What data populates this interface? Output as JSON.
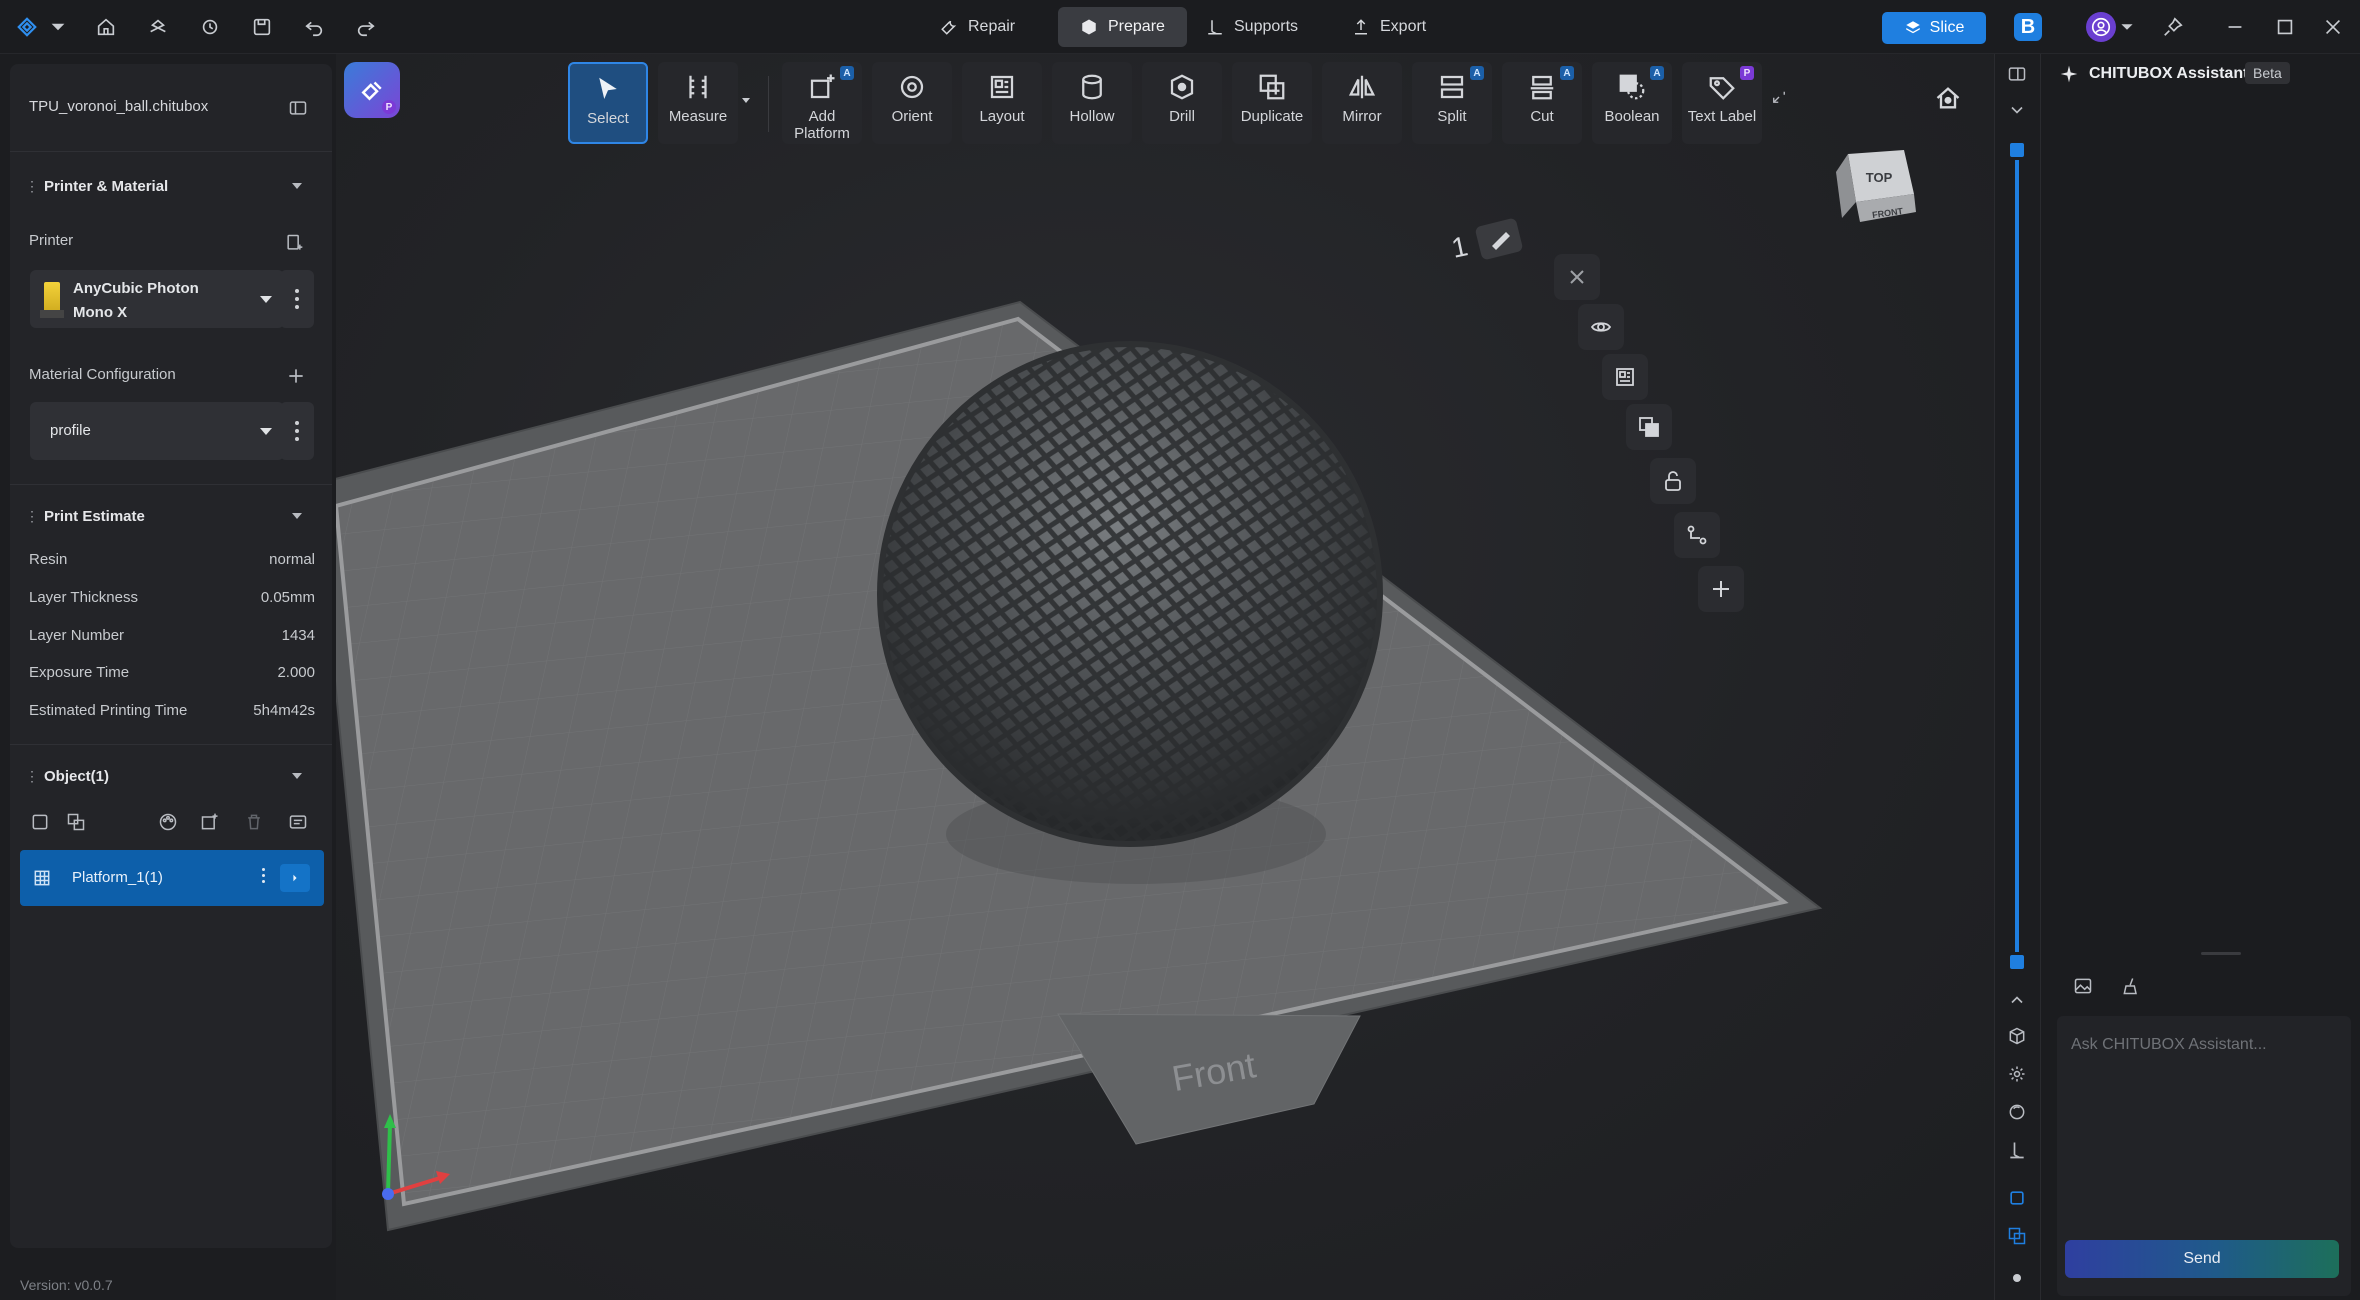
{
  "titlebar": {
    "modes": [
      {
        "label": "Repair",
        "icon": "wrench-icon"
      },
      {
        "label": "Prepare",
        "icon": "cube-icon",
        "active": true
      },
      {
        "label": "Supports",
        "icon": "support-icon"
      },
      {
        "label": "Export",
        "icon": "export-icon"
      }
    ],
    "slice_label": "Slice",
    "b_badge": "B"
  },
  "left_panel": {
    "file_name": "TPU_voronoi_ball.chitubox",
    "printer_material": {
      "title": "Printer & Material",
      "printer_label": "Printer",
      "printer_name_line1": "AnyCubic Photon",
      "printer_name_line2": "Mono X",
      "material_label": "Material Configuration",
      "material_value": "profile"
    },
    "print_estimate": {
      "title": "Print Estimate",
      "rows": [
        {
          "label": "Resin",
          "value": "normal"
        },
        {
          "label": "Layer Thickness",
          "value": "0.05mm"
        },
        {
          "label": "Layer Number",
          "value": "1434"
        },
        {
          "label": "Exposure Time",
          "value": "2.000"
        },
        {
          "label": "Estimated Printing Time",
          "value": "5h4m42s"
        }
      ]
    },
    "objects": {
      "title": "Object(1)",
      "platform_item": "Platform_1(1)"
    },
    "version": "Version: v0.0.7"
  },
  "toolbar": {
    "tools": [
      {
        "label": "Select"
      },
      {
        "label": "Measure"
      },
      {
        "label": "Add Platform",
        "badge": "A"
      },
      {
        "label": "Orient"
      },
      {
        "label": "Layout"
      },
      {
        "label": "Hollow"
      },
      {
        "label": "Drill"
      },
      {
        "label": "Duplicate"
      },
      {
        "label": "Mirror"
      },
      {
        "label": "Split",
        "badge": "A"
      },
      {
        "label": "Cut",
        "badge": "A"
      },
      {
        "label": "Boolean",
        "badge": "A"
      },
      {
        "label": "Text Label",
        "badge": "P"
      }
    ],
    "plugin_badge": "P"
  },
  "viewport": {
    "platform_number": "1",
    "front_label": "Front",
    "cube_top": "TOP",
    "cube_front": "FRONT"
  },
  "assistant": {
    "title": "CHITUBOX Assistant",
    "beta": "Beta",
    "placeholder": "Ask CHITUBOX Assistant...",
    "send_label": "Send"
  },
  "colors": {
    "accent": "#1f7fe0",
    "selected_row": "#0d5faa",
    "premium": "#7b3ad6"
  }
}
